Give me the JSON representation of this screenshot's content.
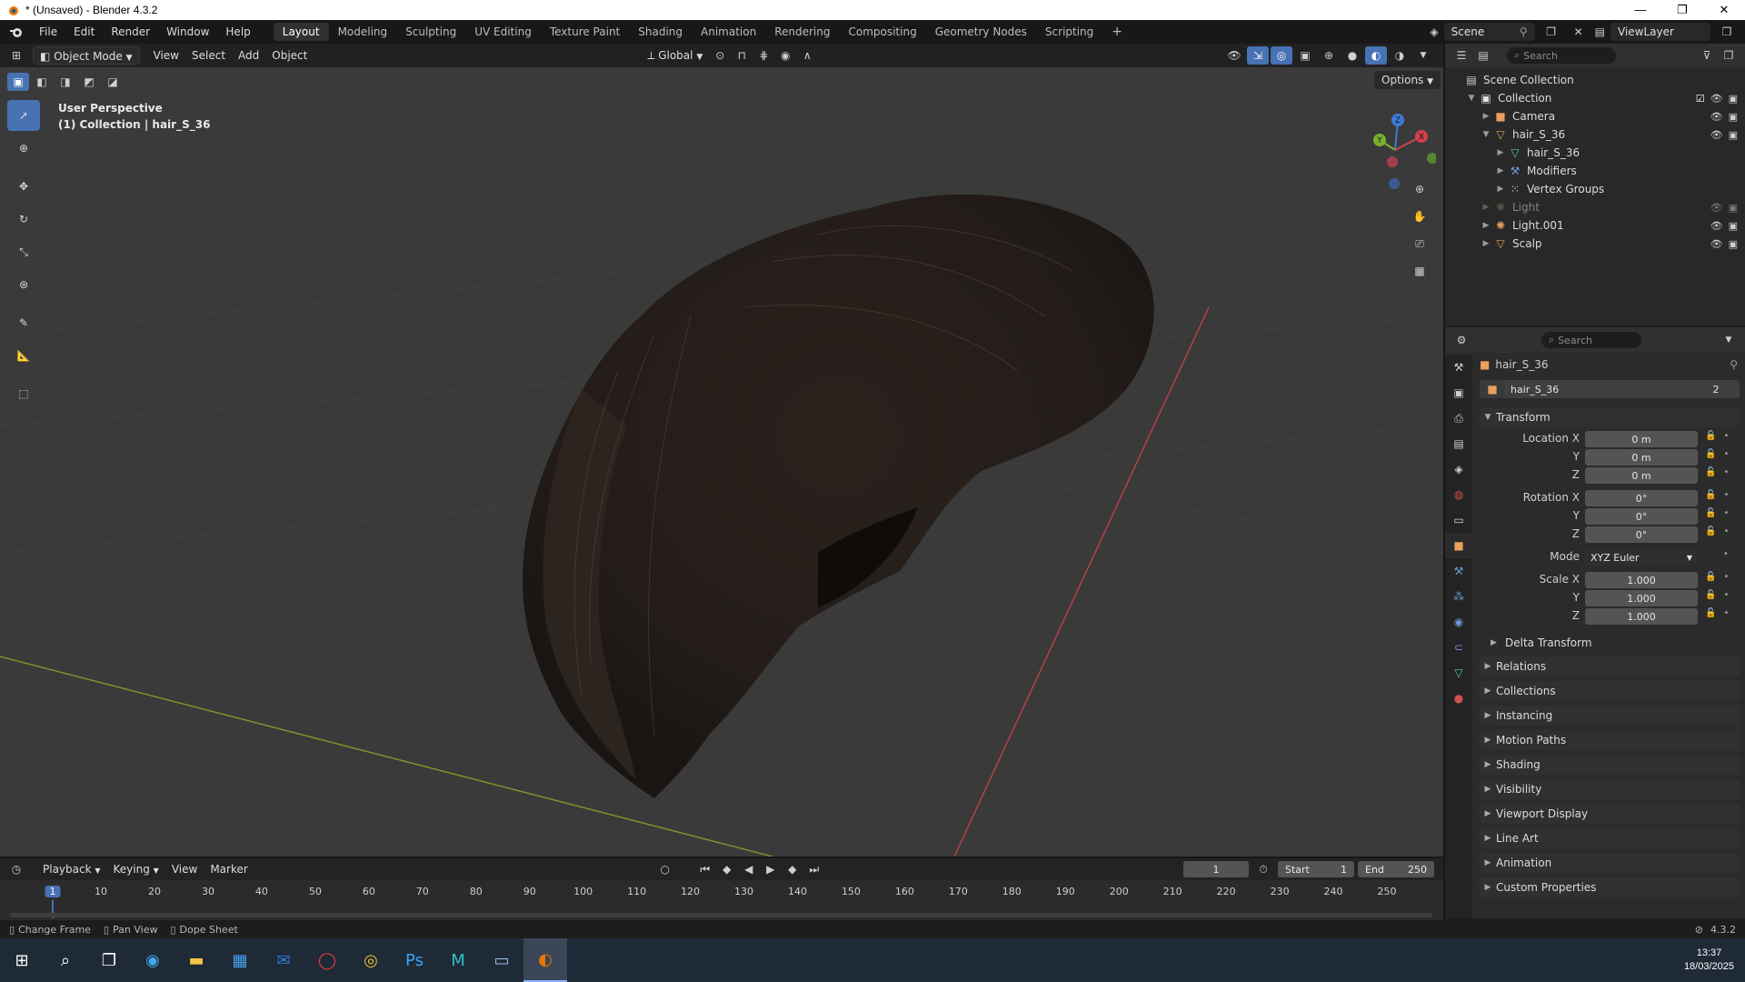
{
  "window": {
    "title": "* (Unsaved) - Blender 4.3.2",
    "controls": [
      "—",
      "❐",
      "✕"
    ]
  },
  "menus": [
    "File",
    "Edit",
    "Render",
    "Window",
    "Help"
  ],
  "workspaces": [
    "Layout",
    "Modeling",
    "Sculpting",
    "UV Editing",
    "Texture Paint",
    "Shading",
    "Animation",
    "Rendering",
    "Compositing",
    "Geometry Nodes",
    "Scripting"
  ],
  "active_workspace": "Layout",
  "workspace_add": "+",
  "scene": {
    "name": "Scene",
    "view_layer": "ViewLayer"
  },
  "viewport": {
    "mode": "Object Mode",
    "menus": [
      "View",
      "Select",
      "Add",
      "Object"
    ],
    "orientation": "Global",
    "options": "Options",
    "info_line1": "User Perspective",
    "info_line2": "(1) Collection | hair_S_36",
    "gizmo_labels": {
      "x": "X",
      "y": "Y",
      "z": "Z"
    }
  },
  "outliner": {
    "search_placeholder": "Search",
    "rows": [
      {
        "label": "Scene Collection",
        "indent": 0,
        "icon": "scene-collection-icon",
        "glyph": "▤",
        "color": "#cfcfcf",
        "expander": ""
      },
      {
        "label": "Collection",
        "indent": 1,
        "icon": "collection-icon",
        "glyph": "▣",
        "color": "#e6e6e6",
        "expander": "▼"
      },
      {
        "label": "Camera",
        "indent": 2,
        "icon": "camera-icon",
        "glyph": "■",
        "color": "#e8a05a",
        "expander": "▶"
      },
      {
        "label": "hair_S_36",
        "indent": 2,
        "icon": "mesh-object-icon",
        "glyph": "▽",
        "color": "#e8a05a",
        "expander": "▼"
      },
      {
        "label": "hair_S_36",
        "indent": 3,
        "icon": "mesh-data-icon",
        "glyph": "▽",
        "color": "#5ec8a0",
        "expander": "▶"
      },
      {
        "label": "Modifiers",
        "indent": 3,
        "icon": "wrench-icon",
        "glyph": "⚒",
        "color": "#6a9bd8",
        "expander": "▶"
      },
      {
        "label": "Vertex Groups",
        "indent": 3,
        "icon": "vertex-groups-icon",
        "glyph": "⁙",
        "color": "#cfcfcf",
        "expander": "▶"
      },
      {
        "label": "Light",
        "indent": 2,
        "icon": "light-icon",
        "glyph": "✺",
        "color": "#8a7a60",
        "expander": "▶",
        "dim": true
      },
      {
        "label": "Light.001",
        "indent": 2,
        "icon": "light-icon",
        "glyph": "✺",
        "color": "#e8a05a",
        "expander": "▶"
      },
      {
        "label": "Scalp",
        "indent": 2,
        "icon": "mesh-object-icon",
        "glyph": "▽",
        "color": "#e8a05a",
        "expander": "▶"
      }
    ]
  },
  "properties": {
    "search_placeholder": "Search",
    "object_name": "hair_S_36",
    "datablock_name": "hair_S_36",
    "users": "2",
    "transform_title": "Transform",
    "location": {
      "label_x": "Location X",
      "label_y": "Y",
      "label_z": "Z",
      "x": "0 m",
      "y": "0 m",
      "z": "0 m"
    },
    "rotation": {
      "label_x": "Rotation X",
      "label_y": "Y",
      "label_z": "Z",
      "x": "0°",
      "y": "0°",
      "z": "0°"
    },
    "mode": {
      "label": "Mode",
      "value": "XYZ Euler"
    },
    "scale": {
      "label_x": "Scale X",
      "label_y": "Y",
      "label_z": "Z",
      "x": "1.000",
      "y": "1.000",
      "z": "1.000"
    },
    "delta_transform": "Delta Transform",
    "panels": [
      "Relations",
      "Collections",
      "Instancing",
      "Motion Paths",
      "Shading",
      "Visibility",
      "Viewport Display",
      "Line Art",
      "Animation",
      "Custom Properties"
    ]
  },
  "timeline": {
    "menus": [
      "Playback",
      "Keying",
      "View",
      "Marker"
    ],
    "current_frame": "1",
    "start_label": "Start",
    "start": "1",
    "end_label": "End",
    "end": "250",
    "ticks": [
      "1",
      "10",
      "20",
      "30",
      "40",
      "50",
      "60",
      "70",
      "80",
      "90",
      "100",
      "110",
      "120",
      "130",
      "140",
      "150",
      "160",
      "170",
      "180",
      "190",
      "200",
      "210",
      "220",
      "230",
      "240",
      "250"
    ]
  },
  "statusbar": {
    "items": [
      "Change Frame",
      "Pan View",
      "Dope Sheet"
    ],
    "version": "4.3.2"
  },
  "taskbar": {
    "time": "13:37",
    "date": "18/03/2025",
    "apps": [
      {
        "name": "start-icon",
        "glyph": "⊞",
        "color": "#ffffff"
      },
      {
        "name": "search-icon",
        "glyph": "⌕",
        "color": "#ffffff"
      },
      {
        "name": "task-view-icon",
        "glyph": "❐",
        "color": "#ffffff"
      },
      {
        "name": "edge-icon",
        "glyph": "◉",
        "color": "#3fa8e8"
      },
      {
        "name": "file-explorer-icon",
        "glyph": "▬",
        "color": "#f5c542"
      },
      {
        "name": "store-icon",
        "glyph": "▦",
        "color": "#4aa3f0"
      },
      {
        "name": "outlook-icon",
        "glyph": "✉",
        "color": "#2b7cd3"
      },
      {
        "name": "opera-icon",
        "glyph": "◯",
        "color": "#e23b3b"
      },
      {
        "name": "chrome-icon",
        "glyph": "◎",
        "color": "#f2c030"
      },
      {
        "name": "photoshop-icon",
        "glyph": "Ps",
        "color": "#31a8ff"
      },
      {
        "name": "maya-icon",
        "glyph": "M",
        "color": "#2ec2c8"
      },
      {
        "name": "notepad-icon",
        "glyph": "▭",
        "color": "#9cc0e8"
      },
      {
        "name": "blender-icon",
        "glyph": "◐",
        "color": "#ea7600"
      }
    ]
  }
}
